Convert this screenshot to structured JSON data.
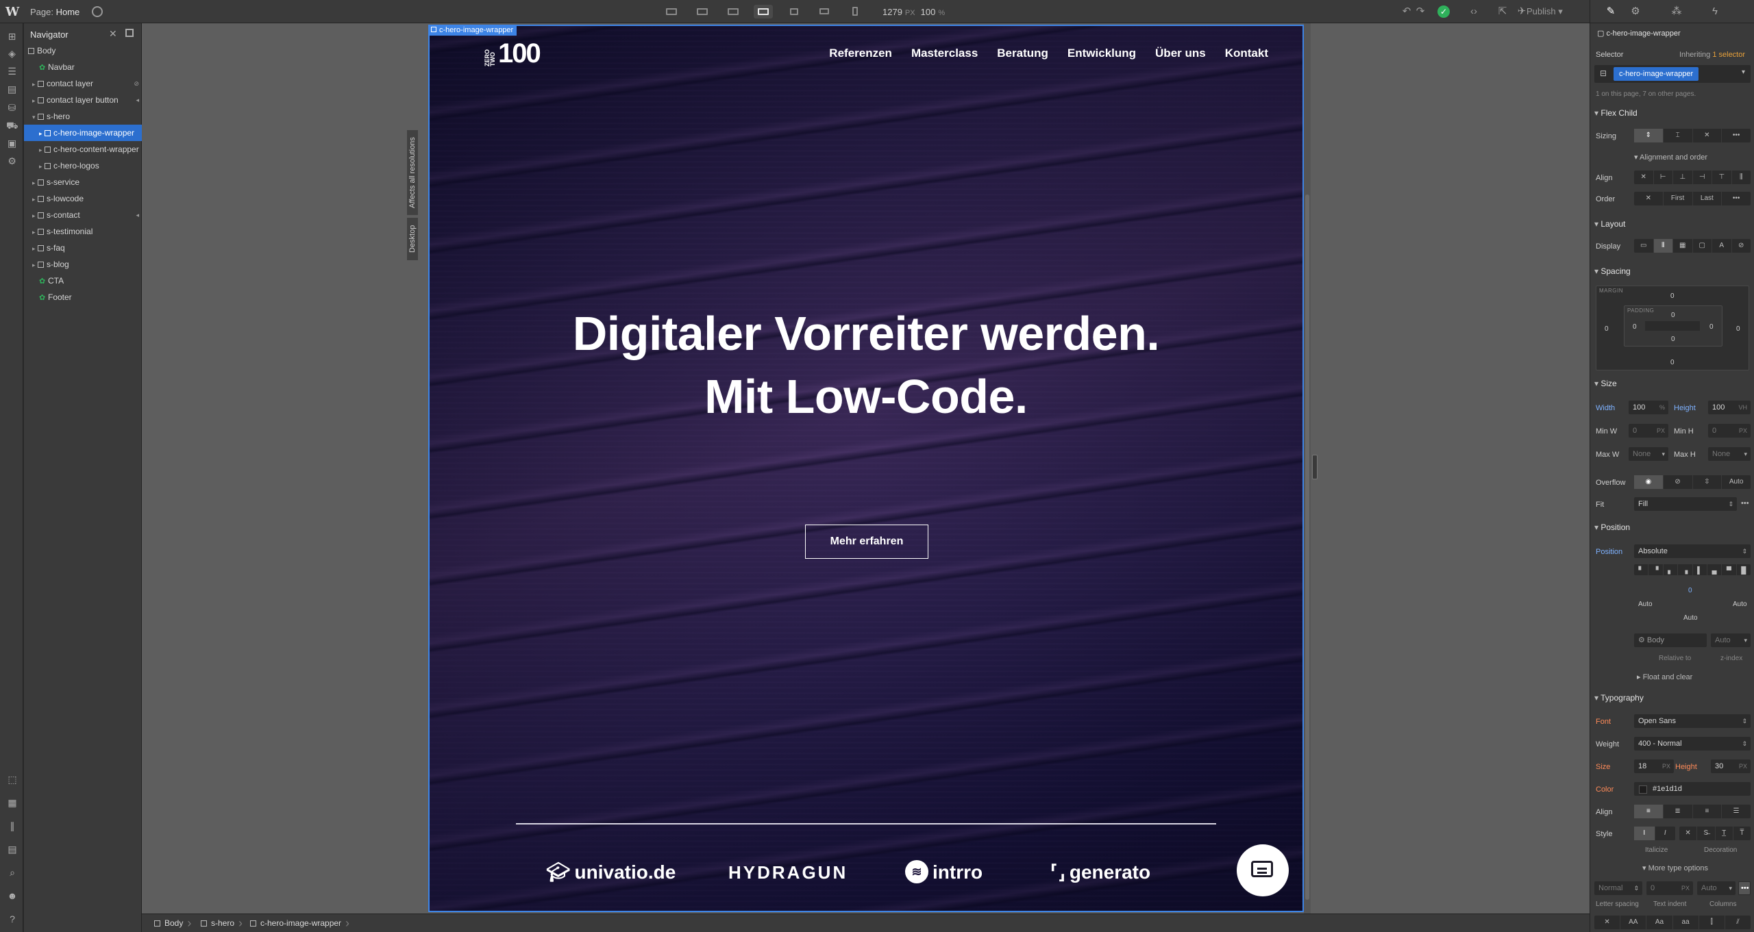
{
  "topbar": {
    "page_prefix": "Page:",
    "page_name": "Home",
    "width_value": "1279",
    "width_unit": "PX",
    "zoom_value": "100",
    "zoom_unit": "%",
    "publish_label": "Publish"
  },
  "navigator": {
    "title": "Navigator",
    "items": [
      {
        "label": "Body"
      },
      {
        "label": "Navbar"
      },
      {
        "label": "contact layer"
      },
      {
        "label": "contact layer button"
      },
      {
        "label": "s-hero"
      },
      {
        "label": "c-hero-image-wrapper"
      },
      {
        "label": "c-hero-content-wrapper"
      },
      {
        "label": "c-hero-logos"
      },
      {
        "label": "s-service"
      },
      {
        "label": "s-lowcode"
      },
      {
        "label": "s-contact"
      },
      {
        "label": "s-testimonial"
      },
      {
        "label": "s-faq"
      },
      {
        "label": "s-blog"
      },
      {
        "label": "CTA"
      },
      {
        "label": "Footer"
      }
    ]
  },
  "canvas": {
    "selected_label": "c-hero-image-wrapper",
    "tag_resolutions": "Affects all resolutions",
    "tag_desktop": "Desktop"
  },
  "site": {
    "logo_small": "ZERO TWO",
    "logo_number": "100",
    "nav": [
      "Referenzen",
      "Masterclass",
      "Beratung",
      "Entwicklung",
      "Über uns",
      "Kontakt"
    ],
    "headline_line1": "Digitaler Vorreiter werden.",
    "headline_line2": "Mit Low-Code.",
    "cta_label": "Mehr erfahren",
    "clients": [
      "univatio.de",
      "HYDRAGUN",
      "intrro",
      "generato"
    ]
  },
  "breadcrumb": [
    "Body",
    "s-hero",
    "c-hero-image-wrapper"
  ],
  "panel": {
    "element_name": "c-hero-image-wrapper",
    "selector_label": "Selector",
    "inheriting_text": "Inheriting",
    "inheriting_count": "1 selector",
    "selector_chip": "c-hero-image-wrapper",
    "selector_note": "1 on this page, 7 on other pages.",
    "flex_child": "Flex Child",
    "sizing": "Sizing",
    "alignment_order": "Alignment and order",
    "align": "Align",
    "order": "Order",
    "order_first": "First",
    "order_last": "Last",
    "layout": "Layout",
    "display": "Display",
    "spacing": "Spacing",
    "margin_label": "MARGIN",
    "padding_label": "PADDING",
    "margin_top": "0",
    "margin_right": "0",
    "margin_bottom": "0",
    "margin_left": "0",
    "padding_top": "0",
    "padding_right": "0",
    "padding_bottom": "0",
    "padding_left": "0",
    "size": "Size",
    "width_label": "Width",
    "width_value": "100",
    "width_unit": "%",
    "height_label": "Height",
    "height_value": "100",
    "height_unit": "VH",
    "minw_label": "Min W",
    "minw_value": "0",
    "minw_unit": "PX",
    "minh_label": "Min H",
    "minh_value": "0",
    "minh_unit": "PX",
    "maxw_label": "Max W",
    "maxw_value": "None",
    "maxh_label": "Max H",
    "maxh_value": "None",
    "overflow_label": "Overflow",
    "overflow_auto": "Auto",
    "fit_label": "Fit",
    "fit_value": "Fill",
    "position_section": "Position",
    "position_label": "Position",
    "position_value": "Absolute",
    "pos_top": "0",
    "pos_left": "Auto",
    "pos_right": "Auto",
    "pos_bottom": "Auto",
    "relative_value": "Body",
    "relative_label": "Relative to",
    "zindex_value": "Auto",
    "zindex_label": "z-index",
    "float_clear": "Float and clear",
    "typography": "Typography",
    "font_label": "Font",
    "font_value": "Open Sans",
    "weight_label": "Weight",
    "weight_value": "400 - Normal",
    "tsize_label": "Size",
    "tsize_value": "18",
    "tsize_unit": "PX",
    "theight_label": "Height",
    "theight_value": "30",
    "theight_unit": "PX",
    "color_label": "Color",
    "color_value": "#1e1d1d",
    "talign_label": "Align",
    "style_label": "Style",
    "italicize": "Italicize",
    "decoration": "Decoration",
    "more_type": "More type options",
    "normal_value": "Normal",
    "ls_value": "0",
    "ls_unit": "PX",
    "ti_value": "Auto",
    "letter_spacing": "Letter spacing",
    "text_indent": "Text indent",
    "columns": "Columns"
  },
  "colors": {
    "accent": "#2c6fcf",
    "selection_border": "#3d84e6",
    "status_ok": "#2fb15b",
    "panel_bg": "#3a3a3a",
    "label_highlight": "#7fb2ff",
    "label_override": "#ff8b59"
  }
}
